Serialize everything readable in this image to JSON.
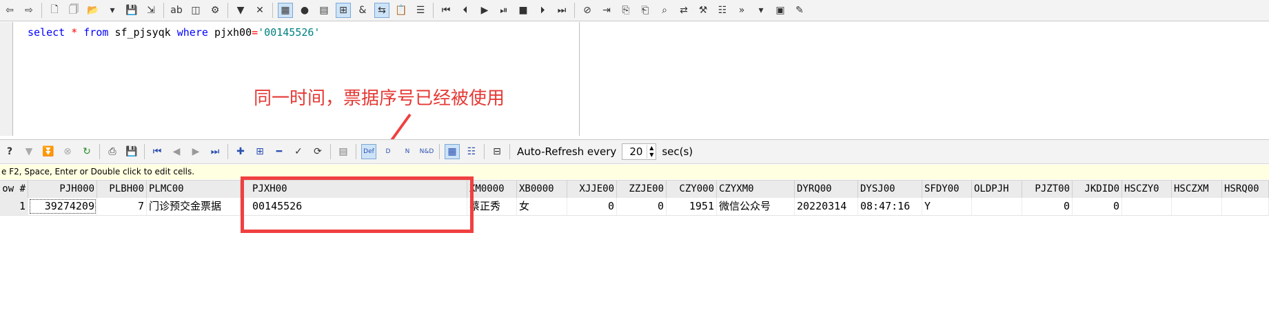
{
  "editor": {
    "sql": {
      "kw_select": "select",
      "star": "*",
      "kw_from": "from",
      "table": "sf_pjsyqk",
      "kw_where": "where",
      "column": "pjxh00",
      "eq": "=",
      "value": "'00145526'"
    }
  },
  "annotation": {
    "text": "同一时间，票据序号已经被使用",
    "color": "#e53935"
  },
  "grid_toolbar": {
    "def_label": "Def",
    "d_label": "D",
    "n_label": "N",
    "nd_label": "N&D",
    "auto_refresh_label": "Auto-Refresh every",
    "auto_refresh_value": "20",
    "secs_label": "sec(s)"
  },
  "hint": "e F2, Space, Enter or Double click to edit cells.",
  "table": {
    "headers": [
      "ow #",
      "PJH000",
      "PLBH00",
      "PLMC00",
      "PJXH00",
      "XM0000",
      "XB0000",
      "XJJE00",
      "ZZJE00",
      "CZY000",
      "CZYXM0",
      "DYRQ00",
      "DYSJ00",
      "SFDY00",
      "OLDPJH",
      "PJZT00",
      "JKDID0",
      "HSCZY0",
      "HSCZXM",
      "HSRQ00"
    ],
    "rows": [
      [
        "1",
        "39274209",
        "7",
        "门诊预交金票据",
        "00145526",
        "蔡正秀",
        "女",
        "0",
        "0",
        "1951",
        "微信公众号",
        "20220314",
        "08:47:16",
        "Y",
        "",
        "0",
        "0",
        "",
        "",
        ""
      ]
    ]
  },
  "colors": {
    "highlight": "#f04040",
    "keyword": "#0000ff",
    "string": "#008080",
    "hint_bg": "#ffffe1"
  }
}
